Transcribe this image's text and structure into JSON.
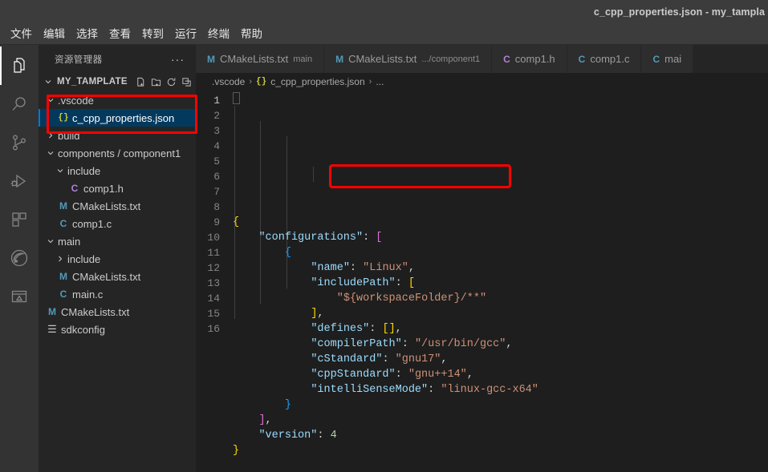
{
  "window": {
    "title": "c_cpp_properties.json - my_tampla"
  },
  "menubar": {
    "items": [
      {
        "label": "文件"
      },
      {
        "label": "编辑"
      },
      {
        "label": "选择"
      },
      {
        "label": "查看"
      },
      {
        "label": "转到"
      },
      {
        "label": "运行"
      },
      {
        "label": "终端"
      },
      {
        "label": "帮助"
      }
    ]
  },
  "activitybar": {
    "items": [
      {
        "name": "explorer-icon",
        "active": true
      },
      {
        "name": "search-icon",
        "active": false
      },
      {
        "name": "source-control-icon",
        "active": false
      },
      {
        "name": "run-and-debug-icon",
        "active": false
      },
      {
        "name": "extensions-icon",
        "active": false
      },
      {
        "name": "espressif-idf-icon",
        "active": false
      },
      {
        "name": "remote-explorer-icon",
        "active": false
      }
    ]
  },
  "sidebar": {
    "header_title": "资源管理器",
    "header_more": "···",
    "root_label": "MY_TAMPLATE",
    "root_actions": [
      "new-file-icon",
      "new-folder-icon",
      "refresh-icon",
      "collapse-all-icon"
    ],
    "tree": [
      {
        "label": ".vscode",
        "icon": "folder-open",
        "indent": 1,
        "twisty": "down",
        "selected": false
      },
      {
        "label": "c_cpp_properties.json",
        "icon": "json",
        "indent": 2,
        "twisty": "none",
        "selected": true
      },
      {
        "label": "build",
        "icon": "folder",
        "indent": 1,
        "twisty": "right",
        "selected": false
      },
      {
        "label": "components / component1",
        "icon": "folder-open",
        "indent": 1,
        "twisty": "down",
        "selected": false
      },
      {
        "label": "include",
        "icon": "folder-open",
        "indent": 2,
        "twisty": "down",
        "selected": false
      },
      {
        "label": "comp1.h",
        "icon": "ch",
        "indent": 3,
        "twisty": "none",
        "selected": false
      },
      {
        "label": "CMakeLists.txt",
        "icon": "cmake",
        "indent": 2,
        "twisty": "none",
        "selected": false
      },
      {
        "label": "comp1.c",
        "icon": "cc",
        "indent": 2,
        "twisty": "none",
        "selected": false
      },
      {
        "label": "main",
        "icon": "folder-open",
        "indent": 1,
        "twisty": "down",
        "selected": false
      },
      {
        "label": "include",
        "icon": "folder",
        "indent": 2,
        "twisty": "right",
        "selected": false
      },
      {
        "label": "CMakeLists.txt",
        "icon": "cmake",
        "indent": 2,
        "twisty": "none",
        "selected": false
      },
      {
        "label": "main.c",
        "icon": "cc",
        "indent": 2,
        "twisty": "none",
        "selected": false
      },
      {
        "label": "CMakeLists.txt",
        "icon": "cmake",
        "indent": 1,
        "twisty": "none",
        "selected": false
      },
      {
        "label": "sdkconfig",
        "icon": "cfg",
        "indent": 1,
        "twisty": "none",
        "selected": false
      }
    ]
  },
  "editor": {
    "tabs": [
      {
        "icon": "M",
        "icon_color": "#519aba",
        "label": "CMakeLists.txt",
        "sub": "main",
        "active": false
      },
      {
        "icon": "M",
        "icon_color": "#519aba",
        "label": "CMakeLists.txt",
        "sub": ".../component1",
        "active": false
      },
      {
        "icon": "C",
        "icon_color": "#b180d7",
        "label": "comp1.h",
        "sub": "",
        "active": false
      },
      {
        "icon": "C",
        "icon_color": "#519aba",
        "label": "comp1.c",
        "sub": "",
        "active": false
      },
      {
        "icon": "C",
        "icon_color": "#519aba",
        "label": "mai",
        "sub": "",
        "active": false
      }
    ],
    "breadcrumb": {
      "folder": ".vscode",
      "sep1": "›",
      "json_icon": "{}",
      "file": "c_cpp_properties.json",
      "sep2": "›",
      "more": "..."
    },
    "line_numbers": [
      "1",
      "2",
      "3",
      "4",
      "5",
      "6",
      "7",
      "8",
      "9",
      "10",
      "11",
      "12",
      "13",
      "14",
      "15",
      "16"
    ],
    "lines": [
      {
        "n": 1,
        "text": "{"
      },
      {
        "n": 2,
        "text": "    \"configurations\": ["
      },
      {
        "n": 3,
        "text": "        {"
      },
      {
        "n": 4,
        "text": "            \"name\": \"Linux\","
      },
      {
        "n": 5,
        "text": "            \"includePath\": ["
      },
      {
        "n": 6,
        "text": "                \"${workspaceFolder}/**\""
      },
      {
        "n": 7,
        "text": "            ],"
      },
      {
        "n": 8,
        "text": "            \"defines\": [],"
      },
      {
        "n": 9,
        "text": "            \"compilerPath\": \"/usr/bin/gcc\","
      },
      {
        "n": 10,
        "text": "            \"cStandard\": \"gnu17\","
      },
      {
        "n": 11,
        "text": "            \"cppStandard\": \"gnu++14\","
      },
      {
        "n": 12,
        "text": "            \"intelliSenseMode\": \"linux-gcc-x64\""
      },
      {
        "n": 13,
        "text": "        }"
      },
      {
        "n": 14,
        "text": "    ],"
      },
      {
        "n": 15,
        "text": "    \"version\": 4"
      },
      {
        "n": 16,
        "text": "}"
      }
    ],
    "json_values": {
      "name": "Linux",
      "includePath": [
        "${workspaceFolder}/**"
      ],
      "defines": [],
      "compilerPath": "/usr/bin/gcc",
      "cStandard": "gnu17",
      "cppStandard": "gnu++14",
      "intelliSenseMode": "linux-gcc-x64",
      "version": 4
    }
  },
  "annotations": {
    "color": "#ff0000",
    "boxes": [
      {
        "name": "vscode-folder-highlight",
        "target": ".vscode / c_cpp_properties.json"
      },
      {
        "name": "workspace-folder-highlight",
        "target": "\"${workspaceFolder}/**\""
      }
    ]
  }
}
